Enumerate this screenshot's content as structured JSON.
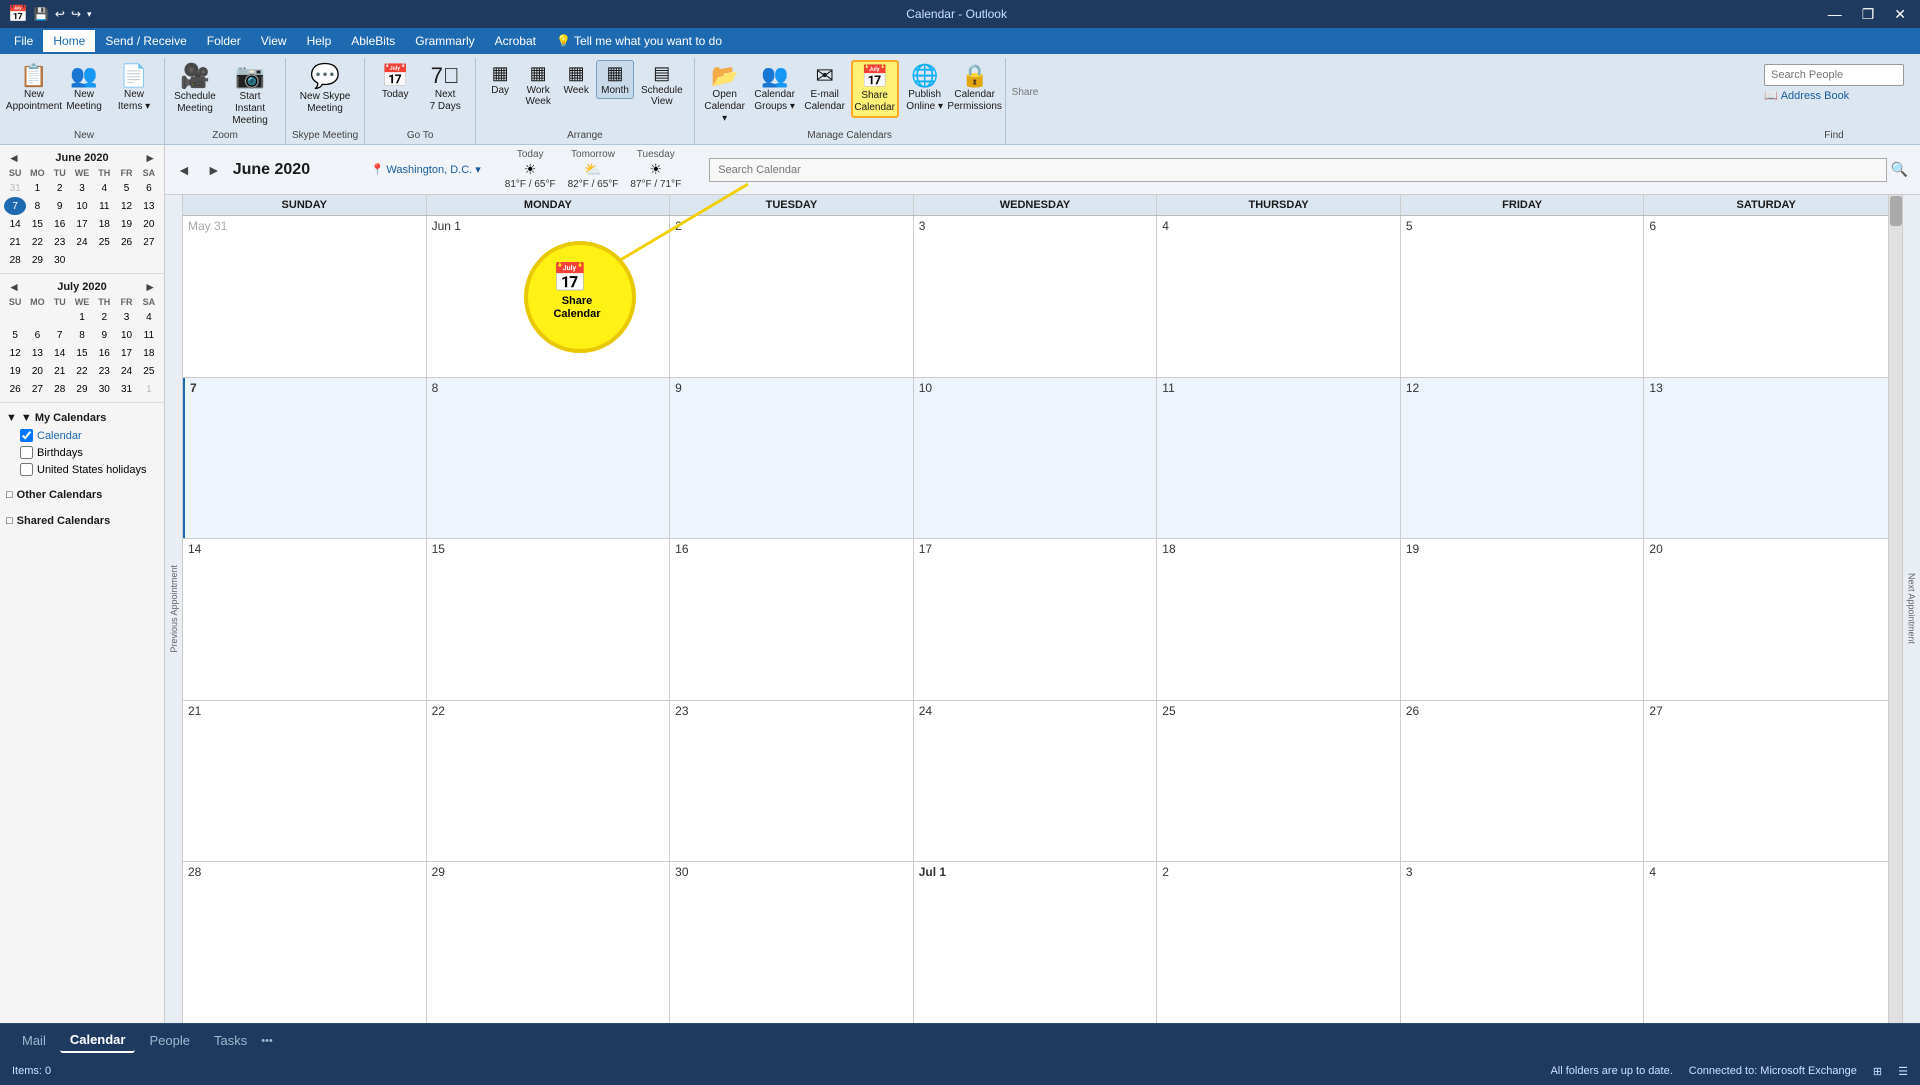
{
  "titleBar": {
    "appName": "Calendar - Outlook",
    "quickAccessIcons": [
      "💾",
      "↩",
      "↪"
    ],
    "windowControls": [
      "—",
      "❐",
      "✕"
    ]
  },
  "menuBar": {
    "items": [
      "File",
      "Home",
      "Send / Receive",
      "Folder",
      "View",
      "Help",
      "AbleBits",
      "Grammarly",
      "Acrobat",
      "💡 Tell me what you want to do"
    ]
  },
  "ribbon": {
    "groups": [
      {
        "label": "New",
        "buttons": [
          {
            "id": "new-appointment",
            "icon": "📋",
            "label": "New\nAppointment"
          },
          {
            "id": "new-meeting",
            "icon": "👥",
            "label": "New\nMeeting"
          },
          {
            "id": "new-items",
            "icon": "📄▾",
            "label": "New\nItems ▾"
          }
        ]
      },
      {
        "label": "Zoom",
        "buttons": [
          {
            "id": "schedule-meeting",
            "icon": "🎥",
            "label": "Schedule\nMeeting"
          },
          {
            "id": "start-instant",
            "icon": "📷",
            "label": "Start Instant\nMeeting"
          }
        ]
      },
      {
        "label": "Skype Meeting",
        "buttons": [
          {
            "id": "new-skype",
            "icon": "💬",
            "label": "New Skype\nMeeting"
          }
        ]
      },
      {
        "label": "Go To",
        "buttons": [
          {
            "id": "today",
            "icon": "📅",
            "label": "Today"
          },
          {
            "id": "next-7-days",
            "icon": "⬡",
            "label": "Next\n7 Days"
          }
        ]
      },
      {
        "label": "Arrange",
        "buttons": [
          {
            "id": "day-view",
            "icon": "▦",
            "label": "Day"
          },
          {
            "id": "work-week",
            "icon": "▦",
            "label": "Work\nWeek"
          },
          {
            "id": "week-view",
            "icon": "▦",
            "label": "Week"
          },
          {
            "id": "month-view",
            "icon": "▦",
            "label": "Month"
          },
          {
            "id": "schedule-view",
            "icon": "▤",
            "label": "Schedule\nView"
          }
        ]
      },
      {
        "label": "Manage Calendars",
        "buttons": [
          {
            "id": "open-calendar",
            "icon": "📂",
            "label": "Open\nCalendar ▾"
          },
          {
            "id": "calendar-groups",
            "icon": "👥",
            "label": "Calendar\nGroups ▾"
          },
          {
            "id": "email-calendar",
            "icon": "✉",
            "label": "E-mail\nCalendar"
          },
          {
            "id": "share-calendar",
            "icon": "📅",
            "label": "Share\nCalendar"
          },
          {
            "id": "publish-online",
            "icon": "🌐",
            "label": "Publish\nOnline ▾"
          },
          {
            "id": "calendar-permissions",
            "icon": "🔒",
            "label": "Calendar\nPermissions"
          }
        ]
      },
      {
        "label": "Share",
        "sublabel": ""
      }
    ],
    "find": {
      "searchPeoplePlaceholder": "Search People",
      "addressBookLabel": "Address Book",
      "groupLabel": "Find"
    }
  },
  "calendarToolbar": {
    "prevNav": "◄",
    "nextNav": "►",
    "monthYear": "June 2020",
    "location": "Washington, D.C. ▾",
    "weather": [
      {
        "label": "Today",
        "icon": "☀",
        "temp": "81°F / 65°F"
      },
      {
        "label": "Tomorrow",
        "icon": "⛅",
        "temp": "82°F / 65°F"
      },
      {
        "label": "Tuesday",
        "icon": "☀",
        "temp": "87°F / 71°F"
      }
    ],
    "searchPlaceholder": "Search Calendar",
    "searchIcon": "🔍"
  },
  "miniCalendars": [
    {
      "title": "June 2020",
      "days": [
        "SU",
        "MO",
        "TU",
        "WE",
        "TH",
        "FR",
        "SA"
      ],
      "weeks": [
        [
          31,
          1,
          2,
          3,
          4,
          5,
          6
        ],
        [
          7,
          8,
          9,
          10,
          11,
          12,
          13
        ],
        [
          14,
          15,
          16,
          17,
          18,
          19,
          20
        ],
        [
          21,
          22,
          23,
          24,
          25,
          26,
          27
        ],
        [
          28,
          29,
          30,
          null,
          null,
          null,
          null
        ]
      ],
      "today": 7,
      "otherMonth": [
        31
      ]
    },
    {
      "title": "July 2020",
      "days": [
        "SU",
        "MO",
        "TU",
        "WE",
        "TH",
        "FR",
        "SA"
      ],
      "weeks": [
        [
          null,
          null,
          null,
          1,
          2,
          3,
          4
        ],
        [
          5,
          6,
          7,
          8,
          9,
          10,
          11
        ],
        [
          12,
          13,
          14,
          15,
          16,
          17,
          18
        ],
        [
          19,
          20,
          21,
          22,
          23,
          24,
          25
        ],
        [
          26,
          27,
          28,
          29,
          30,
          31,
          1
        ]
      ],
      "otherMonth": [
        1
      ]
    }
  ],
  "myCals": {
    "sectionLabel": "▼ My Calendars",
    "items": [
      {
        "label": "Calendar",
        "checked": true
      },
      {
        "label": "Birthdays",
        "checked": false
      },
      {
        "label": "United States holidays",
        "checked": false
      }
    ]
  },
  "otherCals": {
    "sectionLabel": "□ Other Calendars"
  },
  "sharedCals": {
    "sectionLabel": "□ Shared Calendars"
  },
  "calendarHeaders": [
    "SUNDAY",
    "MONDAY",
    "TUESDAY",
    "WEDNESDAY",
    "THURSDAY",
    "FRIDAY",
    "SATURDAY"
  ],
  "calendarWeeks": [
    [
      {
        "date": "May 31",
        "isOtherMonth": true
      },
      {
        "date": "Jun 1",
        "isOtherMonth": false
      },
      {
        "date": "2",
        "isOtherMonth": false
      },
      {
        "date": "3",
        "isOtherMonth": false
      },
      {
        "date": "4",
        "isOtherMonth": false
      },
      {
        "date": "5",
        "isOtherMonth": false
      },
      {
        "date": "6",
        "isOtherMonth": false
      }
    ],
    [
      {
        "date": "7",
        "isOtherMonth": false,
        "isToday": false,
        "isCurrentWeek": true
      },
      {
        "date": "8",
        "isOtherMonth": false,
        "isCurrentWeek": true
      },
      {
        "date": "9",
        "isOtherMonth": false,
        "isCurrentWeek": true
      },
      {
        "date": "10",
        "isOtherMonth": false,
        "isCurrentWeek": true
      },
      {
        "date": "11",
        "isOtherMonth": false,
        "isCurrentWeek": true
      },
      {
        "date": "12",
        "isOtherMonth": false,
        "isCurrentWeek": true
      },
      {
        "date": "13",
        "isOtherMonth": false,
        "isCurrentWeek": true
      }
    ],
    [
      {
        "date": "14",
        "isOtherMonth": false
      },
      {
        "date": "15",
        "isOtherMonth": false
      },
      {
        "date": "16",
        "isOtherMonth": false
      },
      {
        "date": "17",
        "isOtherMonth": false
      },
      {
        "date": "18",
        "isOtherMonth": false
      },
      {
        "date": "19",
        "isOtherMonth": false
      },
      {
        "date": "20",
        "isOtherMonth": false
      }
    ],
    [
      {
        "date": "21",
        "isOtherMonth": false
      },
      {
        "date": "22",
        "isOtherMonth": false
      },
      {
        "date": "23",
        "isOtherMonth": false
      },
      {
        "date": "24",
        "isOtherMonth": false
      },
      {
        "date": "25",
        "isOtherMonth": false
      },
      {
        "date": "26",
        "isOtherMonth": false
      },
      {
        "date": "27",
        "isOtherMonth": false
      }
    ],
    [
      {
        "date": "28",
        "isOtherMonth": false
      },
      {
        "date": "29",
        "isOtherMonth": false
      },
      {
        "date": "30",
        "isOtherMonth": false
      },
      {
        "date": "Jul 1",
        "isOtherMonth": false
      },
      {
        "date": "2",
        "isOtherMonth": false
      },
      {
        "date": "3",
        "isOtherMonth": false
      },
      {
        "date": "4",
        "isOtherMonth": false
      }
    ]
  ],
  "statusBar": {
    "items": "Items: 0",
    "syncStatus": "All folders are up to date.",
    "connection": "Connected to: Microsoft Exchange",
    "viewIcons": [
      "⊞",
      "☰"
    ]
  },
  "navTabs": {
    "items": [
      "Mail",
      "Calendar",
      "People",
      "Tasks",
      "•••"
    ],
    "active": "Calendar"
  },
  "shareTooltip": {
    "icon": "📅",
    "line1": "Share",
    "line2": "Calendar"
  },
  "prevAppointment": "Previous Appointment",
  "nextAppointment": "Next Appointment"
}
